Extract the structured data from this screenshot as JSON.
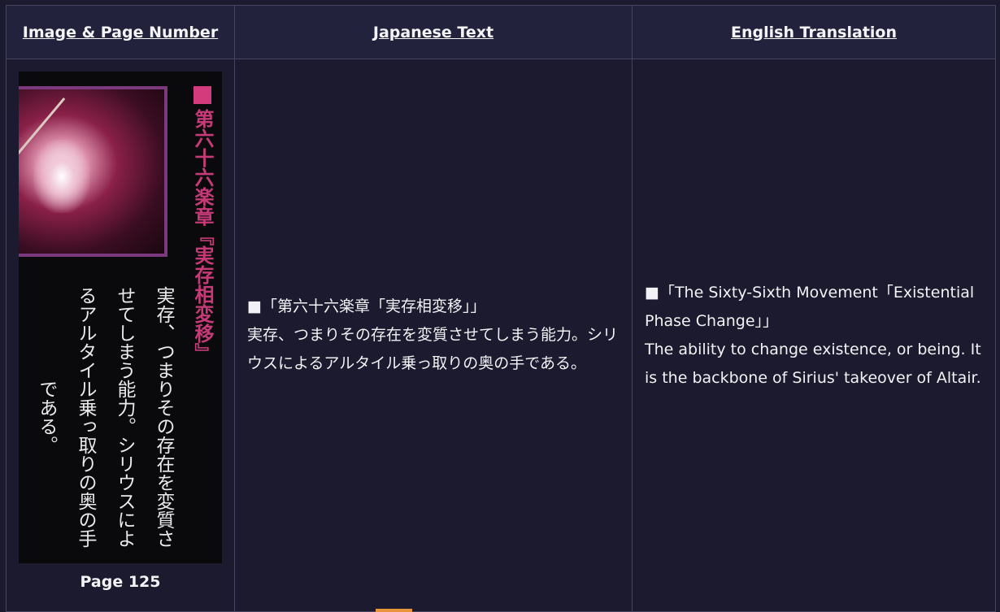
{
  "headers": {
    "image": "Image & Page Number",
    "japanese": "Japanese Text",
    "english": "English Translation"
  },
  "scan": {
    "title": "第六十六楽章『実存相変移』",
    "body": "実存、つまりその存在を変質させてしまう能力。シリウスによるアルタイル乗っ取りの奥の手である。"
  },
  "page_label": "Page 125",
  "japanese": {
    "line1": "■「第六十六楽章「実存相変移」」",
    "line2": "実存、つまりその存在を変質させてしまう能力。シリウスによるアルタイル乗っ取りの奥の手である。"
  },
  "english": {
    "line1": "■「The Sixty-Sixth Movement「Existential Phase Change」」",
    "line2": "The ability to change existence, or being. It is the backbone of Sirius' takeover of Altair."
  },
  "colors": {
    "background": "#1b1a2e",
    "header_bg": "#22223d",
    "border": "#454562",
    "accent": "#e8943a",
    "scan_title": "#c73a78"
  }
}
